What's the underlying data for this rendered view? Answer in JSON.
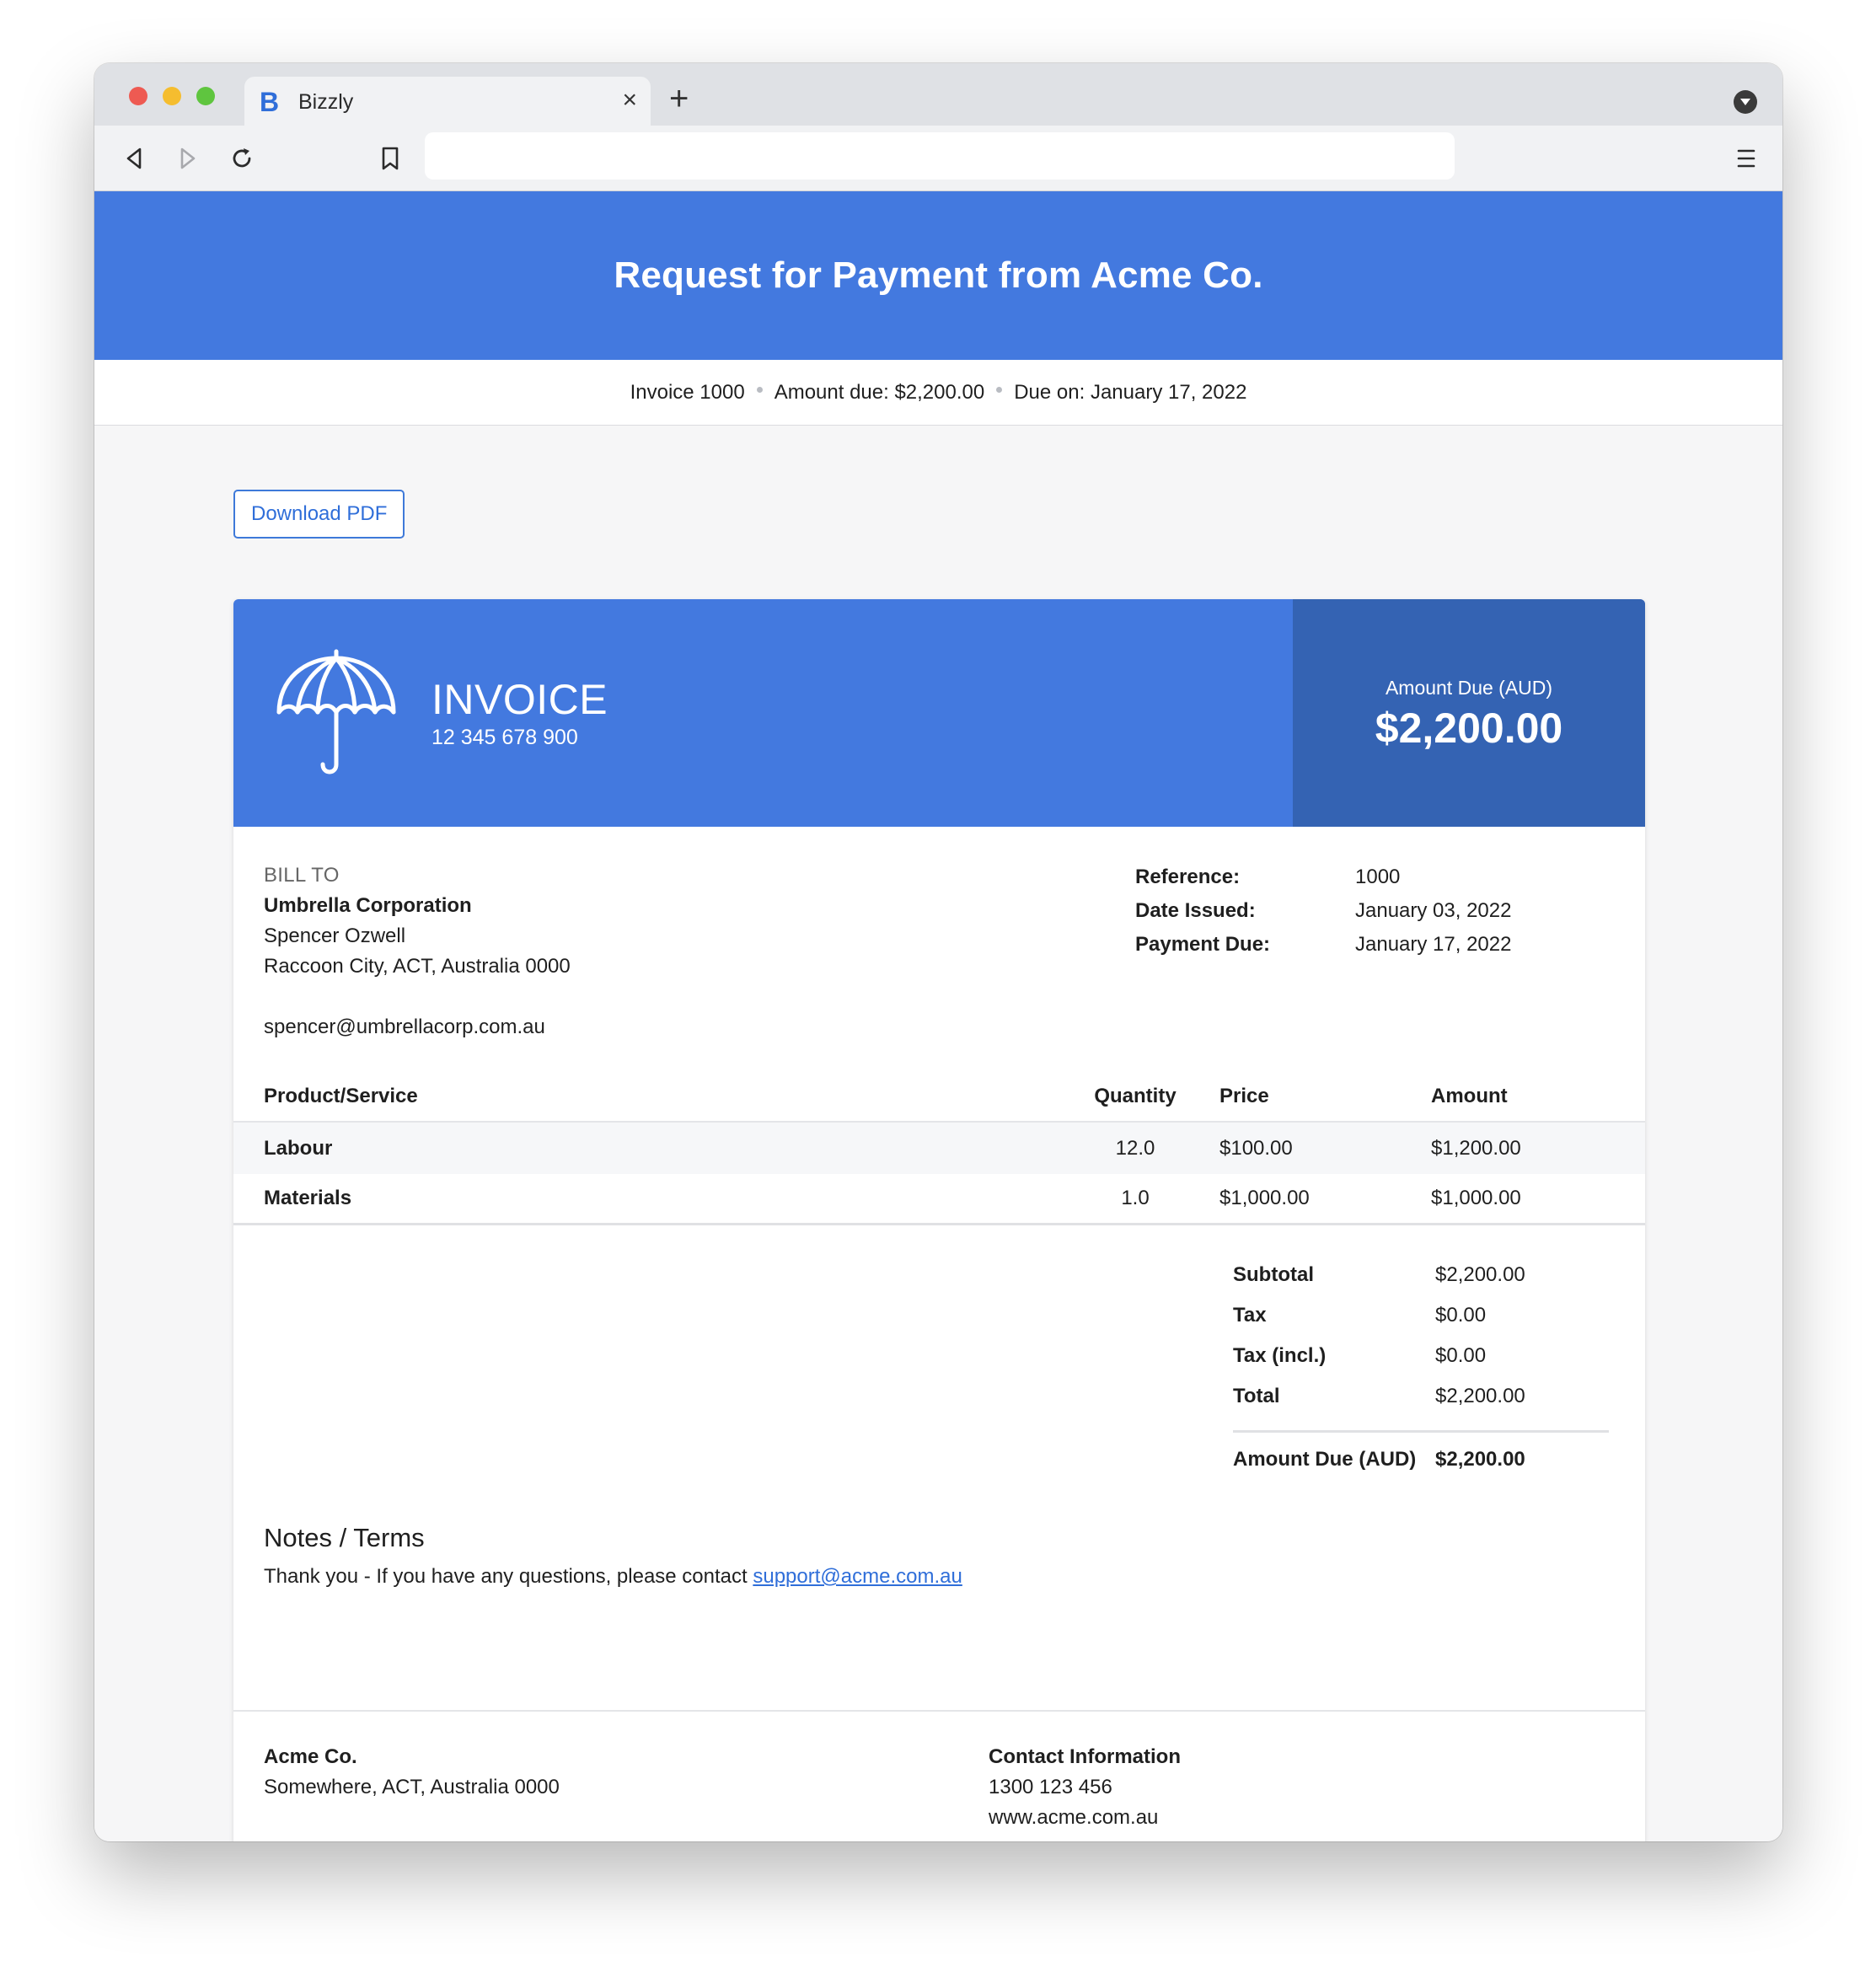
{
  "browser": {
    "tab_favicon": "B",
    "tab_title": "Bizzly",
    "tab_close": "×",
    "new_tab": "+",
    "address": ""
  },
  "hero": {
    "title": "Request for Payment from Acme Co."
  },
  "summary": {
    "invoice": "Invoice 1000",
    "amount_due": "Amount due: $2,200.00",
    "due_on": "Due on: January 17, 2022"
  },
  "download_label": "Download PDF",
  "invoice": {
    "title": "INVOICE",
    "abn": "12 345 678 900",
    "amount_due_label": "Amount Due (AUD)",
    "amount_due_value": "$2,200.00",
    "bill_to": {
      "label": "BILL TO",
      "company": "Umbrella Corporation",
      "contact": "Spencer Ozwell",
      "address": "Raccoon City, ACT, Australia 0000",
      "email": "spencer@umbrellacorp.com.au"
    },
    "meta": [
      {
        "key": "Reference:",
        "value": "1000"
      },
      {
        "key": "Date Issued:",
        "value": "January 03, 2022"
      },
      {
        "key": "Payment Due:",
        "value": "January 17, 2022"
      }
    ],
    "columns": {
      "product": "Product/Service",
      "quantity": "Quantity",
      "price": "Price",
      "amount": "Amount"
    },
    "items": [
      {
        "product": "Labour",
        "quantity": "12.0",
        "price": "$100.00",
        "amount": "$1,200.00"
      },
      {
        "product": "Materials",
        "quantity": "1.0",
        "price": "$1,000.00",
        "amount": "$1,000.00"
      }
    ],
    "totals": [
      {
        "key": "Subtotal",
        "value": "$2,200.00"
      },
      {
        "key": "Tax",
        "value": "$0.00"
      },
      {
        "key": "Tax (incl.)",
        "value": "$0.00"
      },
      {
        "key": "Total",
        "value": "$2,200.00"
      }
    ],
    "final_total": {
      "key": "Amount Due (AUD)",
      "value": "$2,200.00"
    },
    "notes": {
      "title": "Notes / Terms",
      "text": "Thank you - If you have any questions, please contact ",
      "link": "support@acme.com.au"
    },
    "footer": {
      "company": "Acme Co.",
      "address": "Somewhere, ACT, Australia 0000",
      "contact_title": "Contact Information",
      "phone": "1300 123 456",
      "website": "www.acme.com.au"
    }
  },
  "colors": {
    "brand_blue": "#4379df",
    "dark_blue": "#3463b3",
    "link": "#2f6ed9"
  },
  "icons": [
    "back-icon",
    "forward-icon",
    "reload-icon",
    "bookmark-icon",
    "menu-icon",
    "umbrella-icon"
  ]
}
